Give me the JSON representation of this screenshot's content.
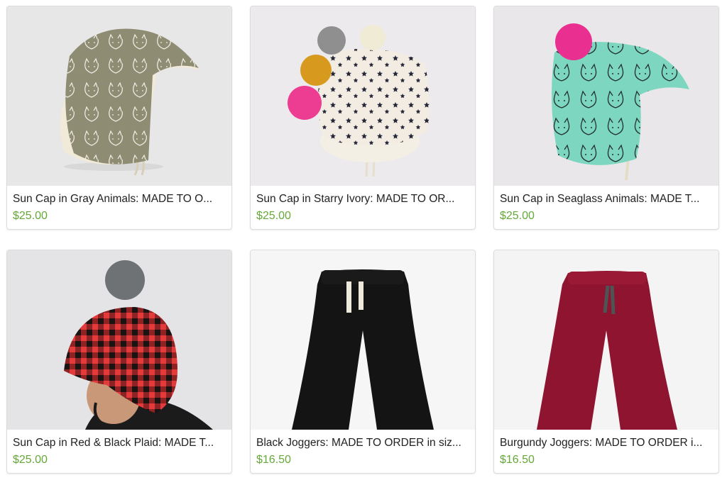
{
  "products": [
    {
      "title": "Sun Cap in Gray Animals: MADE TO O...",
      "price": "$25.00",
      "image": "gray-animal-print-cap"
    },
    {
      "title": "Sun Cap in Starry Ivory: MADE TO OR...",
      "price": "$25.00",
      "image": "starry-ivory-cap-with-pompoms"
    },
    {
      "title": "Sun Cap in Seaglass Animals: MADE T...",
      "price": "$25.00",
      "image": "seaglass-animal-print-cap-with-pompom"
    },
    {
      "title": "Sun Cap in Red & Black Plaid: MADE T...",
      "price": "$25.00",
      "image": "child-wearing-red-black-plaid-cap"
    },
    {
      "title": "Black Joggers: MADE TO ORDER in siz...",
      "price": "$16.50",
      "image": "black-joggers"
    },
    {
      "title": "Burgundy Joggers: MADE TO ORDER i...",
      "price": "$16.50",
      "image": "burgundy-joggers"
    }
  ],
  "colors": {
    "price": "#66a83a",
    "title": "#222222",
    "card_border": "#dcdcdc"
  }
}
